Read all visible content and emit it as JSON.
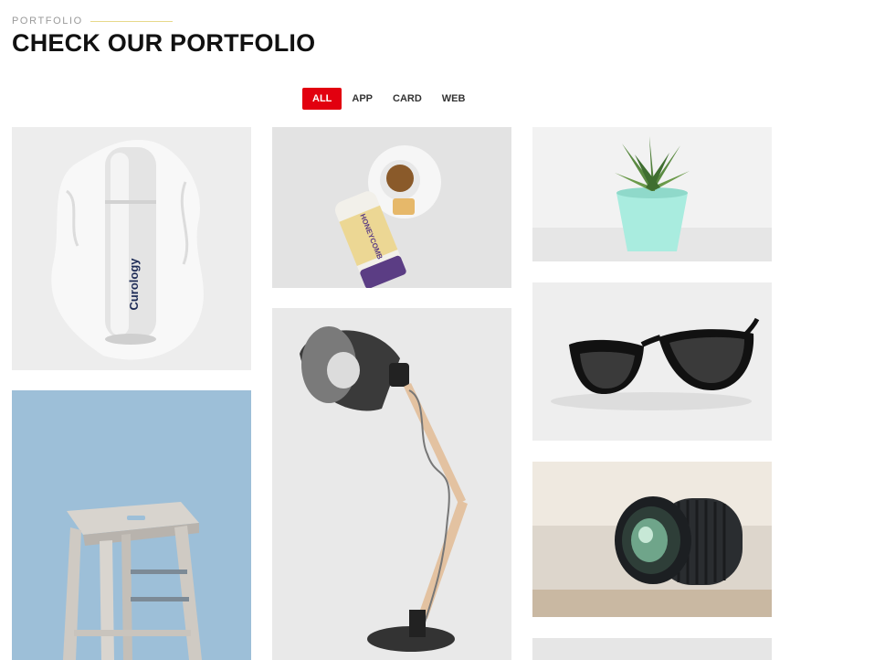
{
  "section": {
    "eyebrow": "PORTFOLIO",
    "title": "CHECK OUR PORTFOLIO"
  },
  "filters": [
    {
      "label": "ALL",
      "active": true
    },
    {
      "label": "APP",
      "active": false
    },
    {
      "label": "CARD",
      "active": false
    },
    {
      "label": "WEB",
      "active": false
    }
  ],
  "portfolio": {
    "items": [
      {
        "subject": "cosmetic-bottle",
        "brand_text": "Curology"
      },
      {
        "subject": "honey-sticks-and-tea",
        "brand_text": "HONEYCOMB"
      },
      {
        "subject": "succulent-plant"
      },
      {
        "subject": "sunglasses"
      },
      {
        "subject": "stool"
      },
      {
        "subject": "desk-lamp"
      },
      {
        "subject": "camera-lens"
      },
      {
        "subject": "partial-item"
      }
    ]
  },
  "colors": {
    "accent": "#e2000f",
    "eyebrow_line": "#e7d98a"
  }
}
